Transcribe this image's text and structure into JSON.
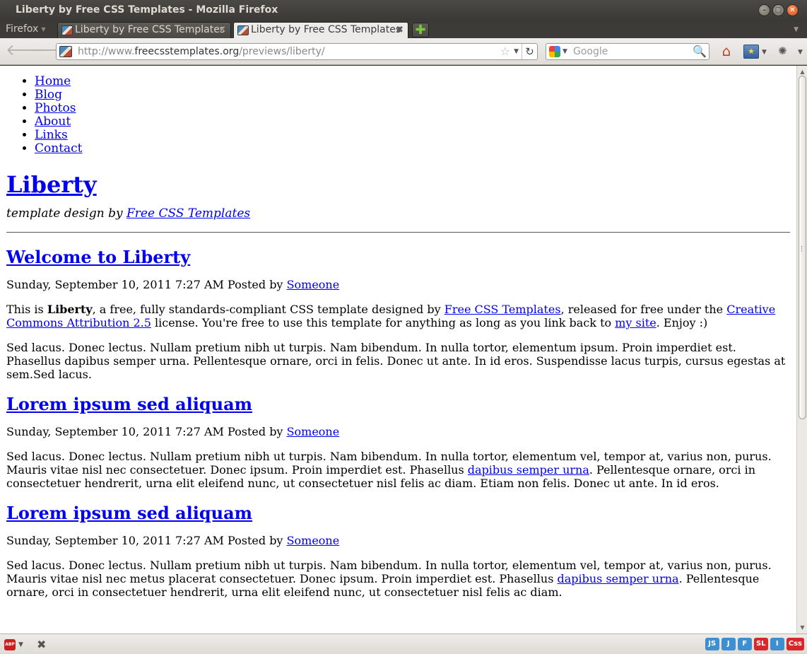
{
  "window": {
    "title": "Liberty by Free CSS Templates - Mozilla Firefox",
    "controls": [
      "–",
      "□",
      "✕"
    ]
  },
  "tabbar": {
    "menu_label": "Firefox",
    "tabs": [
      {
        "label": "Liberty by Free CSS Templates",
        "active": false
      },
      {
        "label": "Liberty by Free CSS Templates",
        "active": true
      }
    ],
    "new_tab_icon": "plus-icon"
  },
  "navbar": {
    "url_prefix": "http://www.",
    "url_domain": "freecsstemplates.org",
    "url_path": "/previews/liberty/",
    "search_placeholder": "Google",
    "search_engine_icon": "google-icon"
  },
  "page": {
    "nav": [
      "Home",
      "Blog",
      "Photos",
      "About",
      "Links",
      "Contact"
    ],
    "site_title": "Liberty",
    "tagline_prefix": "template design by ",
    "tagline_link": "Free CSS Templates",
    "posts": [
      {
        "title": "Welcome to Liberty",
        "meta_text": "Sunday, September 10, 2011 7:27 AM Posted by ",
        "author": "Someone",
        "intro": {
          "t1": "This is ",
          "bold": "Liberty",
          "t2": ", a free, fully standards-compliant CSS template designed by ",
          "link1": "Free CSS Templates",
          "t3": ", released for free under the ",
          "link2": "Creative Commons Attribution 2.5",
          "t4": " license. You're free to use this template for anything as long as you link back to ",
          "link3": "my site",
          "t5": ". Enjoy :)"
        },
        "body": "Sed lacus. Donec lectus. Nullam pretium nibh ut turpis. Nam bibendum. In nulla tortor, elementum ipsum. Proin imperdiet est. Phasellus dapibus semper urna. Pellentesque ornare, orci in felis. Donec ut ante. In id eros. Suspendisse lacus turpis, cursus egestas at sem.Sed lacus."
      },
      {
        "title": "Lorem ipsum sed aliquam",
        "meta_text": "Sunday, September 10, 2011 7:27 AM Posted by ",
        "author": "Someone",
        "body_before": "Sed lacus. Donec lectus. Nullam pretium nibh ut turpis. Nam bibendum. In nulla tortor, elementum vel, tempor at, varius non, purus. Mauris vitae nisl nec consectetuer. Donec ipsum. Proin imperdiet est. Phasellus ",
        "body_link": "dapibus semper urna",
        "body_after": ". Pellentesque ornare, orci in consectetuer hendrerit, urna elit eleifend nunc, ut consectetuer nisl felis ac diam. Etiam non felis. Donec ut ante. In id eros."
      },
      {
        "title": "Lorem ipsum sed aliquam",
        "meta_text": "Sunday, September 10, 2011 7:27 AM Posted by ",
        "author": "Someone",
        "body_before": "Sed lacus. Donec lectus. Nullam pretium nibh ut turpis. Nam bibendum. In nulla tortor, elementum vel, tempor at, varius non, purus. Mauris vitae nisl nec metus placerat consectetuer. Donec ipsum. Proin imperdiet est. Phasellus ",
        "body_link": "dapibus semper urna",
        "body_after": ". Pellentesque ornare, orci in consectetuer hendrerit, urna elit eleifend nunc, ut consectetuer nisl felis ac diam."
      }
    ]
  },
  "statusbar": {
    "abp_label": "ABP",
    "badges": [
      {
        "label": "JS",
        "color": "#3d8fd1"
      },
      {
        "label": "J",
        "color": "#3d8fd1"
      },
      {
        "label": "F",
        "color": "#3d8fd1"
      },
      {
        "label": "SL",
        "color": "#d9262b"
      },
      {
        "label": "I",
        "color": "#3d8fd1"
      },
      {
        "label": "Css",
        "color": "#d9262b"
      }
    ]
  },
  "colors": {
    "link": "#0000ee",
    "chrome_dark": "#3c3b37",
    "toolbar": "#e6e3df"
  }
}
